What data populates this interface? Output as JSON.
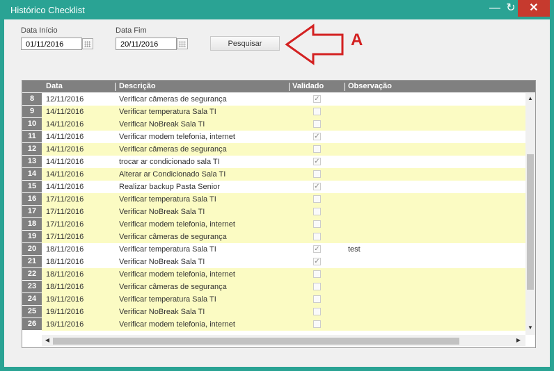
{
  "window": {
    "title": "Histórico Checklist",
    "minimize_glyph": "—",
    "restore_glyph": "↻",
    "close_glyph": "✕"
  },
  "filters": {
    "start_label": "Data Início",
    "start_value": "01/11/2016",
    "end_label": "Data Fim",
    "end_value": "20/11/2016",
    "search_button": "Pesquisar"
  },
  "annotation": {
    "letter": "A",
    "color": "#d32121"
  },
  "grid": {
    "columns": [
      "Data",
      "Descrição",
      "Validado",
      "Observação"
    ],
    "rows": [
      {
        "n": "8",
        "date": "12/11/2016",
        "desc": "Verificar câmeras de segurança",
        "validated": true,
        "obs": "",
        "bg": "white"
      },
      {
        "n": "9",
        "date": "14/11/2016",
        "desc": "Verificar temperatura Sala TI",
        "validated": false,
        "obs": "",
        "bg": "yellow"
      },
      {
        "n": "10",
        "date": "14/11/2016",
        "desc": "Verificar NoBreak Sala TI",
        "validated": false,
        "obs": "",
        "bg": "yellow"
      },
      {
        "n": "11",
        "date": "14/11/2016",
        "desc": "Verificar modem telefonia, internet",
        "validated": true,
        "obs": "",
        "bg": "white"
      },
      {
        "n": "12",
        "date": "14/11/2016",
        "desc": "Verificar câmeras de segurança",
        "validated": false,
        "obs": "",
        "bg": "yellow"
      },
      {
        "n": "13",
        "date": "14/11/2016",
        "desc": "trocar ar condicionado sala TI",
        "validated": true,
        "obs": "",
        "bg": "white"
      },
      {
        "n": "14",
        "date": "14/11/2016",
        "desc": "Alterar ar Condicionado Sala TI",
        "validated": false,
        "obs": "",
        "bg": "yellow"
      },
      {
        "n": "15",
        "date": "14/11/2016",
        "desc": "Realizar backup Pasta Senior",
        "validated": true,
        "obs": "",
        "bg": "white"
      },
      {
        "n": "16",
        "date": "17/11/2016",
        "desc": "Verificar temperatura Sala TI",
        "validated": false,
        "obs": "",
        "bg": "yellow"
      },
      {
        "n": "17",
        "date": "17/11/2016",
        "desc": "Verificar NoBreak Sala TI",
        "validated": false,
        "obs": "",
        "bg": "yellow"
      },
      {
        "n": "18",
        "date": "17/11/2016",
        "desc": "Verificar modem telefonia, internet",
        "validated": false,
        "obs": "",
        "bg": "yellow"
      },
      {
        "n": "19",
        "date": "17/11/2016",
        "desc": "Verificar câmeras de segurança",
        "validated": false,
        "obs": "",
        "bg": "yellow"
      },
      {
        "n": "20",
        "date": "18/11/2016",
        "desc": "Verificar temperatura Sala TI",
        "validated": true,
        "obs": "test",
        "bg": "white"
      },
      {
        "n": "21",
        "date": "18/11/2016",
        "desc": "Verificar NoBreak Sala TI",
        "validated": true,
        "obs": "",
        "bg": "white"
      },
      {
        "n": "22",
        "date": "18/11/2016",
        "desc": "Verificar modem telefonia, internet",
        "validated": false,
        "obs": "",
        "bg": "yellow"
      },
      {
        "n": "23",
        "date": "18/11/2016",
        "desc": "Verificar câmeras de segurança",
        "validated": false,
        "obs": "",
        "bg": "yellow"
      },
      {
        "n": "24",
        "date": "19/11/2016",
        "desc": "Verificar temperatura Sala TI",
        "validated": false,
        "obs": "",
        "bg": "yellow"
      },
      {
        "n": "25",
        "date": "19/11/2016",
        "desc": "Verificar NoBreak Sala TI",
        "validated": false,
        "obs": "",
        "bg": "yellow"
      },
      {
        "n": "26",
        "date": "19/11/2016",
        "desc": "Verificar modem telefonia, internet",
        "validated": false,
        "obs": "",
        "bg": "yellow"
      }
    ]
  },
  "colors": {
    "titlebar": "#2aa394",
    "close": "#c63a2e",
    "row_highlight": "#fbfbc3",
    "header": "#808080"
  }
}
